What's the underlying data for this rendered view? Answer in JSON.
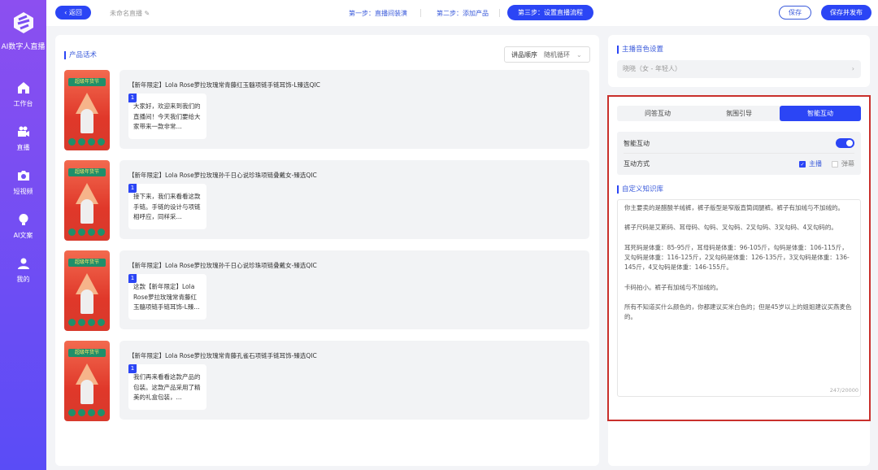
{
  "sidebar": {
    "brand": "AI数字人直播",
    "items": [
      {
        "label": "工作台",
        "icon": "home-icon"
      },
      {
        "label": "直播",
        "icon": "video-camera-icon"
      },
      {
        "label": "短视频",
        "icon": "camera-icon"
      },
      {
        "label": "AI文案",
        "icon": "lightbulb-icon"
      },
      {
        "label": "我的",
        "icon": "user-icon"
      }
    ]
  },
  "topbar": {
    "back": "返回",
    "title": "未命名直播",
    "steps": [
      "第一步：直播间装潢",
      "第二步：添加产品",
      "第三步：设置直播流程"
    ],
    "save": "保存",
    "publish": "保存并发布"
  },
  "left": {
    "title": "产品话术",
    "order_label": "讲品顺序",
    "order_value": "随机循环",
    "thumb_text": "超级年货节",
    "products": [
      {
        "name": "【新年限定】Lola Rose萝拉玫瑰常青藤红玉髓项链手链耳饰-L臻选QIC",
        "num": "1",
        "script": "大家好，欢迎来到我们的直播间！今天我们要给大家带来一款非常..."
      },
      {
        "name": "【新年限定】Lola Rose萝拉玫瑰孙千日心说珍珠项链叠戴女-臻选QIC",
        "num": "1",
        "script": "接下来，我们来看看这款手链。手链的设计与项链相呼应，同样采..."
      },
      {
        "name": "【新年限定】Lola Rose萝拉玫瑰孙千日心说珍珠项链叠戴女-臻选QIC",
        "num": "1",
        "script": "这款【新年限定】Lola Rose萝拉玫瑰常青藤红玉髓项链手链耳饰-L臻..."
      },
      {
        "name": "【新年限定】Lola Rose萝拉玫瑰常青藤孔雀石项链手链耳饰-臻选QIC",
        "num": "1",
        "script": "我们再来看看这款产品的包装。这款产品采用了精美的礼盒包装，..."
      }
    ]
  },
  "right": {
    "voice_title": "主播音色设置",
    "voice_value": "晓晓（女 - 年轻人）",
    "tabs": [
      "问答互动",
      "氛围引导",
      "智能互动"
    ],
    "active_tab": 2,
    "smart_label": "智能互动",
    "smart_on": true,
    "mode_label": "互动方式",
    "mode_anchor": "主播",
    "mode_danmaku": "弹幕",
    "kb_title": "自定义知识库",
    "kb_text": "你主要卖的是醋酸羊绒裤，裤子版型是窄版直筒阔腿裤。裤子有加绒与不加绒的。\n\n裤子尺码是艾斯码、耳母码、勾码、叉勾码、2叉勾码、3叉勾码、4叉勾码的。\n\n耳死码是体重：85-95斤，耳母码是体重：96-105斤，勾码是体重：106-115斤，叉勾码是体重：116-125斤，2叉勾码是体重：126-135斤，3叉勾码是体重：136-145斤，4叉勾码是体重：146-155斤。\n\n卡码拍小。裤子有加绒与不加绒的。\n\n所有不知道买什么颜色的，你都建议买米白色的；但是45岁以上的姐姐建议买燕麦色的。",
    "kb_count": "247/20000"
  },
  "colors": {
    "accent": "#2b45f5",
    "highlight": "#c9302c"
  }
}
